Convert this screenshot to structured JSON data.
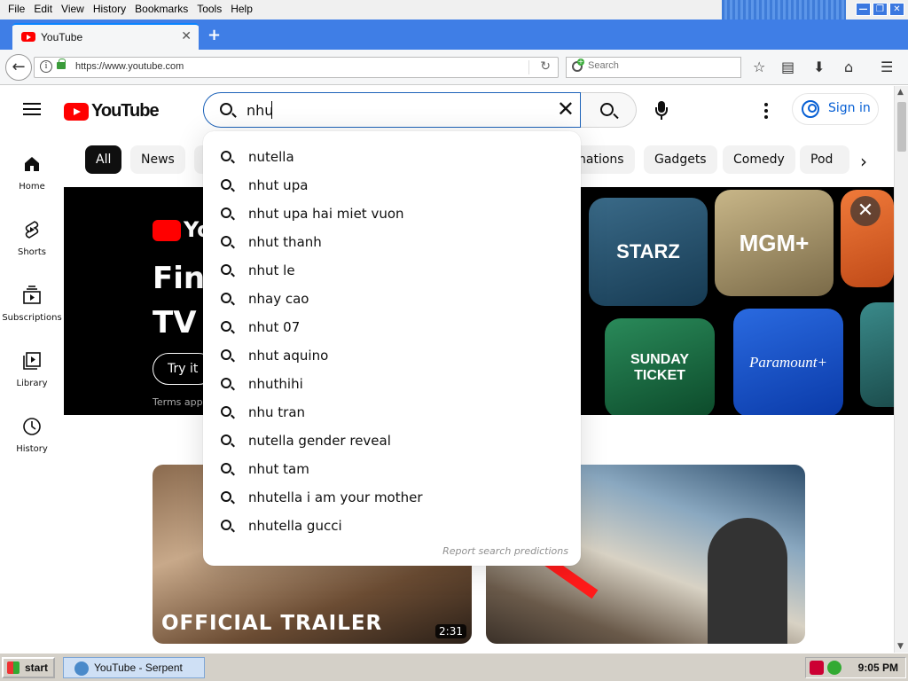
{
  "browser": {
    "menu": [
      "File",
      "Edit",
      "View",
      "History",
      "Bookmarks",
      "Tools",
      "Help"
    ],
    "window_controls": [
      "—",
      "❐",
      "✕"
    ],
    "tab_title": "YouTube",
    "tab_close": "✕",
    "new_tab": "+",
    "url": "https://www.youtube.com",
    "search_placeholder": "Search",
    "back_glyph": "←",
    "reload_glyph": "↻"
  },
  "youtube": {
    "logo_text": "YouTube",
    "search_query": "nhu",
    "search_clear": "✕",
    "sign_in": "Sign in",
    "chips": [
      "All",
      "News",
      "nations",
      "Gadgets",
      "Comedy",
      "Pod"
    ],
    "chip_next": "›",
    "guide": [
      {
        "label": "Home",
        "icon": "home-icon"
      },
      {
        "label": "Shorts",
        "icon": "shorts-icon"
      },
      {
        "label": "Subscriptions",
        "icon": "subscriptions-icon"
      },
      {
        "label": "Library",
        "icon": "library-icon"
      },
      {
        "label": "History",
        "icon": "history-icon"
      }
    ],
    "suggestions": [
      {
        "prefix": "",
        "rest": "nutella"
      },
      {
        "prefix": "nhu",
        "rest": "t upa"
      },
      {
        "prefix": "nhu",
        "rest": "t upa hai miet vuon"
      },
      {
        "prefix": "nhu",
        "rest": "t thanh"
      },
      {
        "prefix": "nhu",
        "rest": "t le"
      },
      {
        "prefix": "",
        "rest": "nhay cao"
      },
      {
        "prefix": "nhu",
        "rest": "t 07"
      },
      {
        "prefix": "nhu",
        "rest": "t aquino"
      },
      {
        "prefix": "nhu",
        "rest": "thihi"
      },
      {
        "prefix": "",
        "rest": "nhu tran"
      },
      {
        "prefix": "",
        "rest": "nutella gender reveal"
      },
      {
        "prefix": "nhu",
        "rest": "t tam"
      },
      {
        "prefix": "nhu",
        "rest": "tella i am your mother"
      },
      {
        "prefix": "nhu",
        "rest": "tella gucci"
      }
    ],
    "report_predictions": "Report search predictions",
    "banner": {
      "logo_text": "You",
      "headline_1": "Find",
      "headline_2": "TV",
      "try_label": "Try it n",
      "terms": "Terms apply",
      "close": "✕",
      "tiles": [
        "STARZ",
        "MGM+",
        "SUNDAY TICKET",
        "Paramount+"
      ]
    },
    "videos": [
      {
        "overlay": "OFFICIAL TRAILER",
        "duration": "2:31"
      },
      {
        "overlay": "",
        "duration": ""
      }
    ]
  },
  "taskbar": {
    "start": "start",
    "task_title": "YouTube - Serpent",
    "clock": "9:05 PM"
  },
  "colors": {
    "yt_red": "#ff0000",
    "search_focus": "#1c62b9",
    "sign_in_blue": "#065fd4",
    "chrome_blue": "#3f7ee6"
  }
}
